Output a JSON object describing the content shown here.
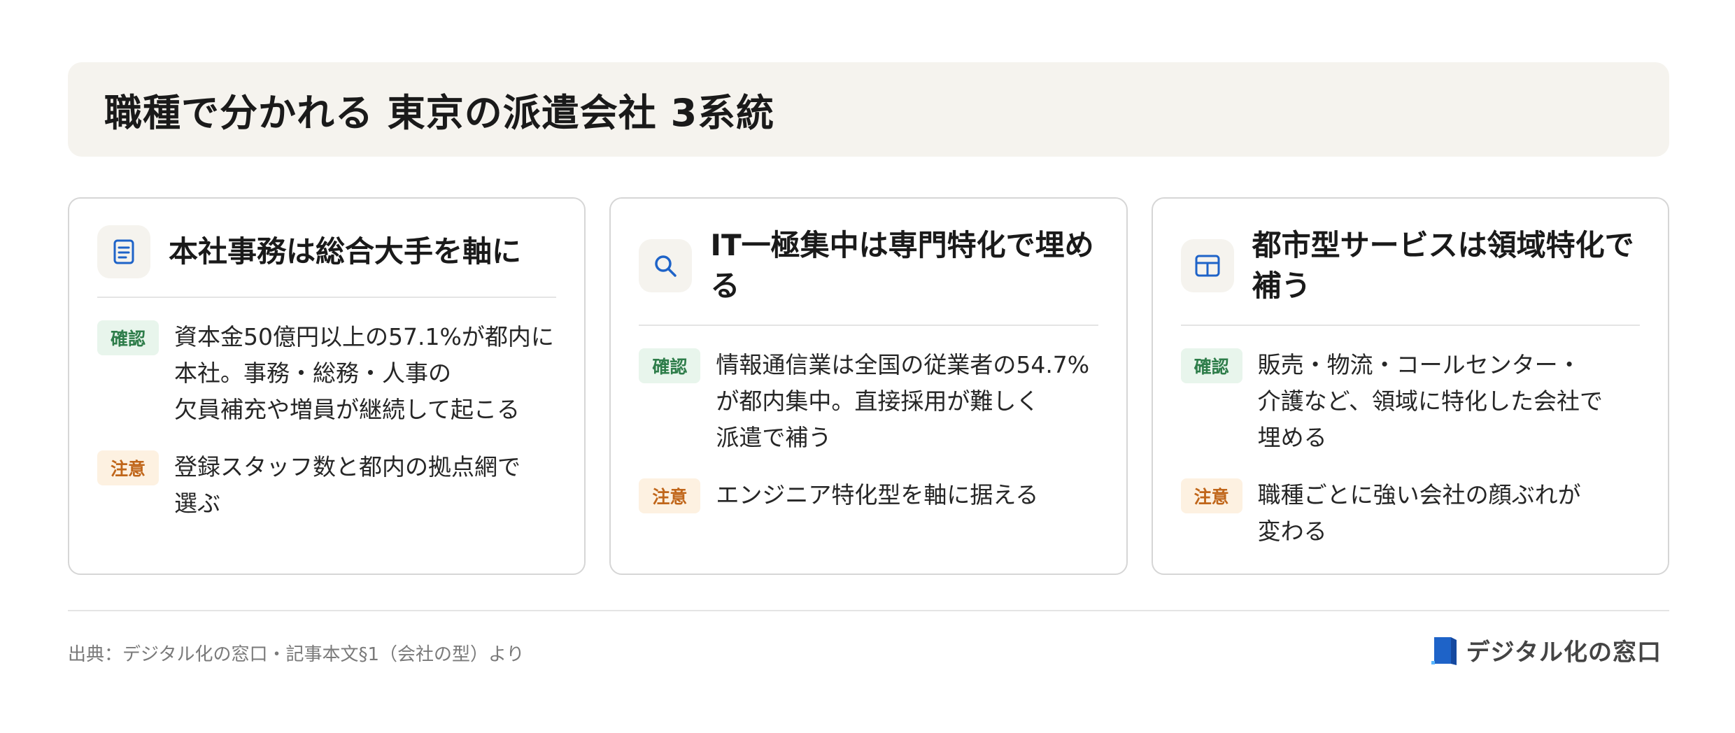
{
  "header": {
    "title": "職種で分かれる 東京の派遣会社 3系統"
  },
  "cards": [
    {
      "icon": "document-icon",
      "title": "本社事務は総合大手を軸に",
      "items": [
        {
          "badge": "確認",
          "kind": "confirm",
          "text": "資本金50億円以上の57.1%が都内に\n本社。事務・総務・人事の\n欠員補充や増員が継続して起こる"
        },
        {
          "badge": "注意",
          "kind": "caution",
          "text": "登録スタッフ数と都内の拠点網で\n選ぶ"
        }
      ]
    },
    {
      "icon": "search-icon",
      "title": "IT一極集中は専門特化で埋め\nる",
      "items": [
        {
          "badge": "確認",
          "kind": "confirm",
          "text": "情報通信業は全国の従業者の54.7%\nが都内集中。直接採用が難しく\n派遣で補う"
        },
        {
          "badge": "注意",
          "kind": "caution",
          "text": "エンジニア特化型を軸に据える"
        }
      ]
    },
    {
      "icon": "grid-icon",
      "title": "都市型サービスは領域特化で\n補う",
      "items": [
        {
          "badge": "確認",
          "kind": "confirm",
          "text": "販売・物流・コールセンター・\n介護など、領域に特化した会社で\n埋める"
        },
        {
          "badge": "注意",
          "kind": "caution",
          "text": "職種ごとに強い会社の顔ぶれが\n変わる"
        }
      ]
    }
  ],
  "footer": {
    "source": "出典：デジタル化の窓口・記事本文§1（会社の型）より",
    "brand": "デジタル化の窓口"
  },
  "colors": {
    "accent_blue": "#1e63c8",
    "confirm_green": "#2e7d4a",
    "caution_orange": "#c0661a",
    "banner_bg": "#f5f3ee"
  }
}
